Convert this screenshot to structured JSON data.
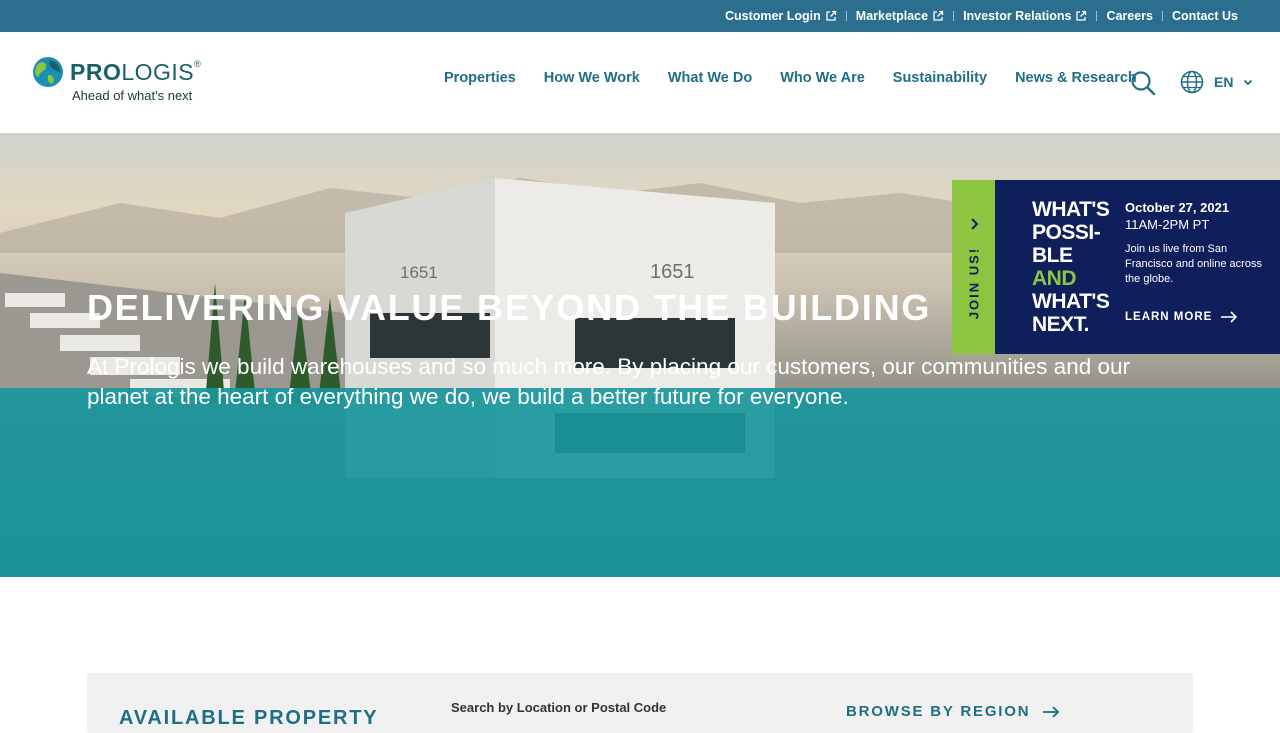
{
  "utility_nav": {
    "items": [
      {
        "label": "Customer Login",
        "external": true
      },
      {
        "label": "Marketplace",
        "external": true
      },
      {
        "label": "Investor Relations",
        "external": true
      },
      {
        "label": "Careers",
        "external": false
      },
      {
        "label": "Contact Us",
        "external": false
      }
    ]
  },
  "brand": {
    "name_bold": "PRO",
    "name_light": "LOGIS",
    "registered": "®",
    "tagline": "Ahead of what's next"
  },
  "main_nav": {
    "items": [
      "Properties",
      "How We Work",
      "What We Do",
      "Who We Are",
      "Sustainability",
      "News & Research"
    ]
  },
  "language": {
    "selected": "EN"
  },
  "hero": {
    "title": "DELIVERING VALUE BEYOND THE BUILDING",
    "text": "At Prologis we build warehouses and so much more. By placing our customers, our communities and our planet at the heart of everything we do, we build a better future for everyone."
  },
  "event": {
    "tab_label": "JOIN US!",
    "logo_lines": [
      "WHAT'S",
      "POSSI-",
      "BLE",
      "AND",
      "WHAT'S",
      "NEXT."
    ],
    "date": "October 27, 2021",
    "time": "11AM-2PM PT",
    "description": "Join us live from San Francisco and online across the globe.",
    "cta": "LEARN MORE"
  },
  "property_search": {
    "heading": "AVAILABLE PROPERTY",
    "location_label": "Search by Location or Postal Code",
    "browse_label": "BROWSE BY REGION"
  },
  "colors": {
    "utility_bar": "#2b6e8e",
    "nav_text": "#1f6f84",
    "hero_band": "#18969b",
    "event_bg": "#0f1f5c",
    "event_tab": "#8cc540"
  }
}
